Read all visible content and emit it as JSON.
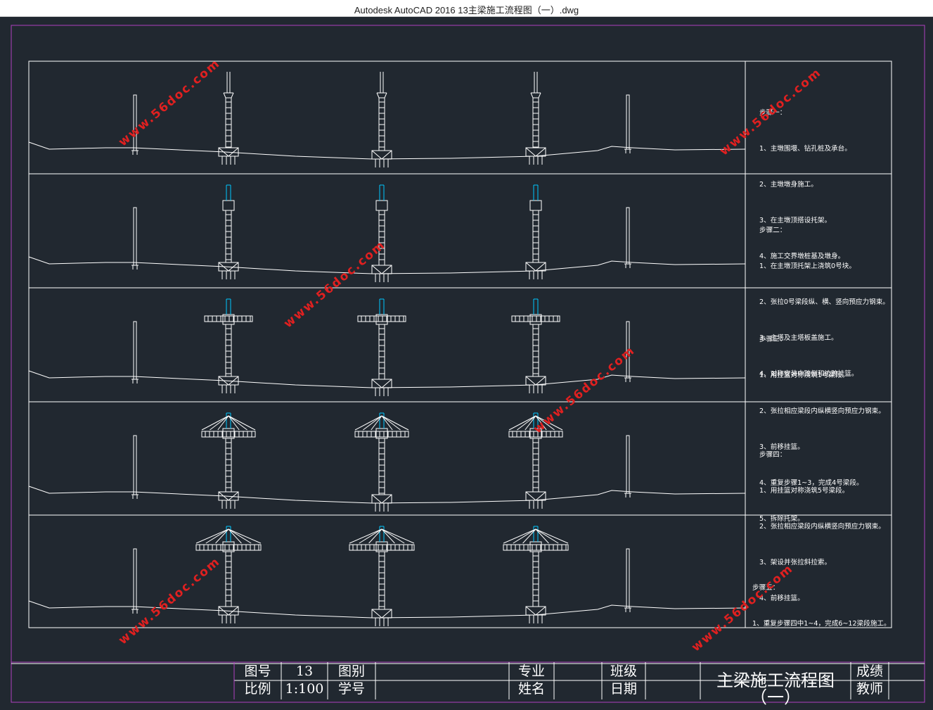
{
  "window": {
    "title": "Autodesk AutoCAD 2016     13主梁施工流程图（一）.dwg"
  },
  "steps": [
    {
      "title": "步骤一：",
      "lines": [
        "1、主墩围堰、钻孔桩及承台。",
        "2、主墩墩身施工。",
        "3、在主墩顶搭设托架。",
        "4、施工交界墩桩基及墩身。"
      ]
    },
    {
      "title": "步骤二：",
      "lines": [
        "1、在主墩顶托架上浇筑0号块。",
        "2、张拉0号梁段纵、横、竖向预应力钢束。",
        "3、主塔及主塔板盖施工。",
        "4、对称安装中跨侧和边跨挂篮。"
      ]
    },
    {
      "title": "步骤三：",
      "lines": [
        "1、用挂篮对称浇筑1号梁段。",
        "2、张拉相应梁段内纵横竖向预应力钢束。",
        "3、前移挂篮。",
        "4、重复步骤1~3，完成4号梁段。",
        "5、拆除托架。"
      ]
    },
    {
      "title": "步骤四：",
      "lines": [
        "1、用挂篮对称浇筑5号梁段。",
        "2、张拉相应梁段内纵横竖向预应力钢束。",
        "3、架设并张拉斜拉索。",
        "4、前移挂篮。"
      ]
    },
    {
      "title": "步骤五：",
      "lines": [
        "1、重复步骤四中1~4，完成6~12梁段施工。"
      ]
    }
  ],
  "title_block": {
    "drawing_no_label": "图号",
    "drawing_no": "13",
    "category_label": "图别",
    "category": "",
    "scale_label": "比例",
    "scale": "1:100",
    "student_no_label": "学号",
    "student_no": "",
    "major_label": "专业",
    "name_label": "姓名",
    "class_label": "班级",
    "date_label": "日期",
    "drawing_title": "主梁施工流程图（一）",
    "grade_label": "成绩",
    "teacher_label": "教师"
  },
  "watermark": {
    "text": "www.56doc.com",
    "color": "#e02020"
  },
  "colors": {
    "background": "#212830",
    "lines": "#ffffff",
    "tower": "#00c8ff",
    "border": "#b040c0"
  }
}
